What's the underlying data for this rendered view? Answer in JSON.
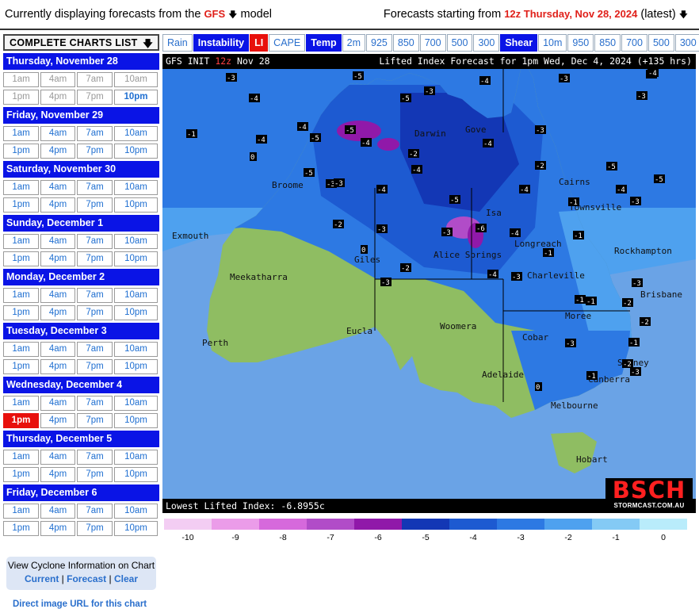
{
  "topbar": {
    "left_prefix": "Currently displaying forecasts from the",
    "model": "GFS",
    "left_suffix": "model",
    "right_prefix": "Forecasts starting from",
    "run": "12z Thursday, Nov 28, 2024",
    "right_suffix": "(latest)"
  },
  "sidebar": {
    "charts_list_label": "COMPLETE CHARTS LIST",
    "days": [
      {
        "label": "Thursday, November 28",
        "times": [
          "1am",
          "4am",
          "7am",
          "10am",
          "1pm",
          "4pm",
          "7pm",
          "10pm"
        ],
        "dim": [
          true,
          true,
          true,
          true,
          true,
          true,
          true,
          false
        ],
        "bold": [
          false,
          false,
          false,
          false,
          false,
          false,
          false,
          true
        ]
      },
      {
        "label": "Friday, November 29",
        "times": [
          "1am",
          "4am",
          "7am",
          "10am",
          "1pm",
          "4pm",
          "7pm",
          "10pm"
        ]
      },
      {
        "label": "Saturday, November 30",
        "times": [
          "1am",
          "4am",
          "7am",
          "10am",
          "1pm",
          "4pm",
          "7pm",
          "10pm"
        ]
      },
      {
        "label": "Sunday, December 1",
        "times": [
          "1am",
          "4am",
          "7am",
          "10am",
          "1pm",
          "4pm",
          "7pm",
          "10pm"
        ]
      },
      {
        "label": "Monday, December 2",
        "times": [
          "1am",
          "4am",
          "7am",
          "10am",
          "1pm",
          "4pm",
          "7pm",
          "10pm"
        ]
      },
      {
        "label": "Tuesday, December 3",
        "times": [
          "1am",
          "4am",
          "7am",
          "10am",
          "1pm",
          "4pm",
          "7pm",
          "10pm"
        ]
      },
      {
        "label": "Wednesday, December 4",
        "times": [
          "1am",
          "4am",
          "7am",
          "10am",
          "1pm",
          "4pm",
          "7pm",
          "10pm"
        ],
        "selected": 4
      },
      {
        "label": "Thursday, December 5",
        "times": [
          "1am",
          "4am",
          "7am",
          "10am",
          "1pm",
          "4pm",
          "7pm",
          "10pm"
        ]
      },
      {
        "label": "Friday, December 6",
        "times": [
          "1am",
          "4am",
          "7am",
          "10am",
          "1pm",
          "4pm",
          "7pm",
          "10pm"
        ]
      }
    ],
    "cyclone_title": "View Cyclone Information on Chart",
    "cyclone_links": [
      "Current",
      "Forecast",
      "Clear"
    ],
    "direct_link": "Direct image URL for this chart"
  },
  "tabs": [
    {
      "label": "Rain",
      "style": "link"
    },
    {
      "label": "Instability",
      "style": "head"
    },
    {
      "label": "LI",
      "style": "red"
    },
    {
      "label": "CAPE",
      "style": "link"
    },
    {
      "label": "Temp",
      "style": "head"
    },
    {
      "label": "2m",
      "style": "link"
    },
    {
      "label": "925",
      "style": "link"
    },
    {
      "label": "850",
      "style": "link"
    },
    {
      "label": "700",
      "style": "link"
    },
    {
      "label": "500",
      "style": "link"
    },
    {
      "label": "300",
      "style": "link"
    },
    {
      "label": "Shear",
      "style": "head"
    },
    {
      "label": "10m",
      "style": "link"
    },
    {
      "label": "950",
      "style": "link"
    },
    {
      "label": "850",
      "style": "link"
    },
    {
      "label": "700",
      "style": "link"
    },
    {
      "label": "500",
      "style": "link"
    },
    {
      "label": "300",
      "style": "link"
    }
  ],
  "map": {
    "title_left_a": "GFS INIT",
    "title_left_b": "12z",
    "title_left_c": "Nov 28",
    "title_right": "Lifted Index Forecast for 1pm Wed, Dec 4, 2024 (+135 hrs)",
    "lowest": "Lowest Lifted Index: -6.8955c",
    "logo_big": "BSCH",
    "logo_small": "STORMCAST.COM.AU",
    "places": [
      "Gove",
      "Darwin",
      "Broome",
      "Cairns",
      "Townsville",
      "Exmouth",
      "Isa",
      "Longreach",
      "Rockhampton",
      "Alice Springs",
      "Giles",
      "Meekatharra",
      "Charleville",
      "Brisbane",
      "Moree",
      "Woomera",
      "Eucla",
      "Perth",
      "Cobar",
      "Sydney",
      "Adelaide",
      "Canberra",
      "Melbourne",
      "Hobart"
    ],
    "li_values": [
      {
        "v": "-3"
      },
      {
        "v": "-4"
      },
      {
        "v": "-5"
      },
      {
        "v": "-3"
      },
      {
        "v": "-4"
      },
      {
        "v": "-3"
      },
      {
        "v": "-6"
      },
      {
        "v": "-3"
      },
      {
        "v": "-4"
      },
      {
        "v": "-4"
      },
      {
        "v": "-5"
      },
      {
        "v": "-4"
      },
      {
        "v": "-2"
      },
      {
        "v": "-4"
      },
      {
        "v": "-3"
      },
      {
        "v": "-1"
      },
      {
        "v": "0"
      },
      {
        "v": "-5"
      },
      {
        "v": "-4"
      },
      {
        "v": "-3"
      },
      {
        "v": "-2"
      },
      {
        "v": "-4"
      },
      {
        "v": "-3"
      },
      {
        "v": "-5"
      },
      {
        "v": "-6"
      },
      {
        "v": "-3"
      },
      {
        "v": "-2"
      },
      {
        "v": "-4"
      },
      {
        "v": "-1"
      },
      {
        "v": "-3"
      },
      {
        "v": "-4"
      },
      {
        "v": "-1"
      },
      {
        "v": "-3"
      },
      {
        "v": "-2"
      },
      {
        "v": "-1"
      },
      {
        "v": "-3"
      },
      {
        "v": "0"
      },
      {
        "v": "-2"
      },
      {
        "v": "-1"
      },
      {
        "v": "-3"
      },
      {
        "v": "-2"
      },
      {
        "v": "-1"
      },
      {
        "v": "0"
      },
      {
        "v": "-2"
      },
      {
        "v": "-1"
      },
      {
        "v": "-1"
      },
      {
        "v": "-4"
      },
      {
        "v": "-3"
      },
      {
        "v": "-3"
      },
      {
        "v": "-5"
      },
      {
        "v": "-5"
      },
      {
        "v": "-4"
      },
      {
        "v": "-5"
      },
      {
        "v": "-4"
      },
      {
        "v": "-3"
      },
      {
        "v": "-5"
      }
    ]
  },
  "legend": {
    "values": [
      "-10",
      "-9",
      "-8",
      "-7",
      "-6",
      "-5",
      "-4",
      "-3",
      "-2",
      "-1",
      "0"
    ],
    "colors": [
      "#f3cdf3",
      "#eb9ce9",
      "#d669dc",
      "#b14cc8",
      "#9019a9",
      "#1337b5",
      "#1d5ad1",
      "#2d79e3",
      "#4ea1ef",
      "#84caf5",
      "#b9ecfb"
    ]
  },
  "colors": {
    "ocean": "#6aa3e6",
    "land_stable": "#8fbd62",
    "accent_blue": "#0a14e6",
    "accent_red": "#e8100c"
  }
}
